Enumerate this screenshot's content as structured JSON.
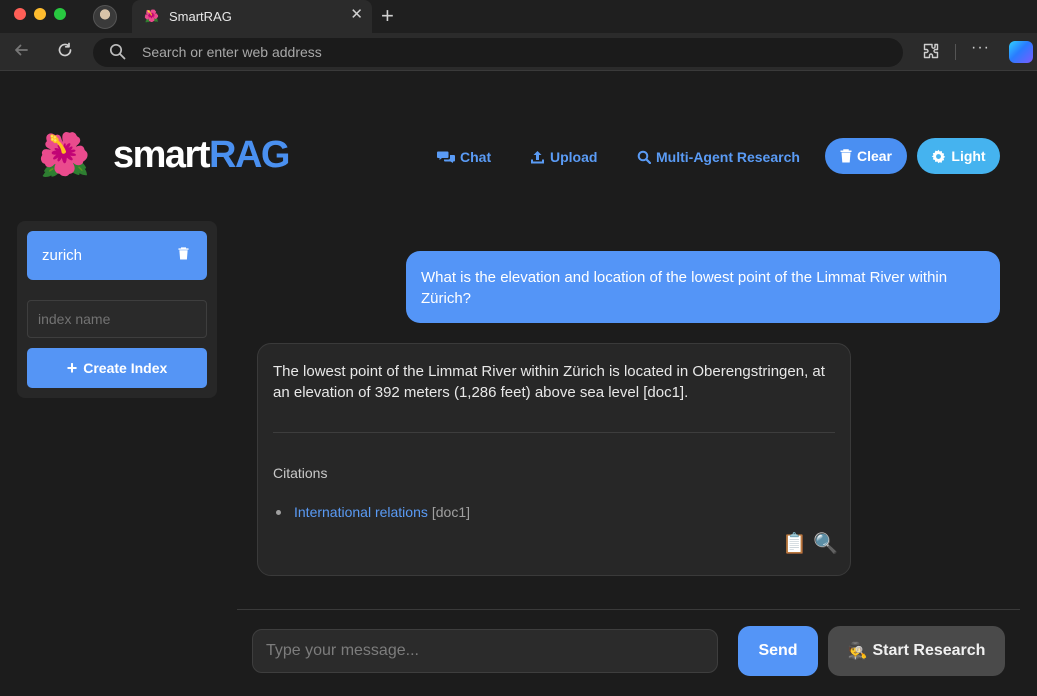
{
  "browser": {
    "tab_title": "SmartRAG",
    "tab_favicon": "🌺",
    "address_placeholder": "Search or enter web address",
    "new_tab_glyph": "+",
    "close_glyph": "✕",
    "more_glyph": "···"
  },
  "header": {
    "logo_emoji": "🌺",
    "logo_smart": "smart",
    "logo_rag": "RAG",
    "nav": {
      "chat": "Chat",
      "upload": "Upload",
      "research": "Multi-Agent Research"
    },
    "clear_label": "Clear",
    "theme_label": "Light"
  },
  "sidebar": {
    "indexes": [
      {
        "name": "zurich"
      }
    ],
    "index_input_placeholder": "index name",
    "create_label": "Create Index",
    "create_prefix": "+"
  },
  "chat": {
    "user_message": "What is the elevation and location of the lowest point of the Limmat River within Zürich?",
    "bot_message": "The lowest point of the Limmat River within Zürich is located in Oberengstringen, at an elevation of 392 meters (1,286 feet) above sea level [doc1].",
    "citations_heading": "Citations",
    "citations": [
      {
        "title": "International relations",
        "ref": "[doc1]"
      }
    ],
    "copy_icon": "📋",
    "inspect_icon": "🔍"
  },
  "composer": {
    "placeholder": "Type your message...",
    "send_label": "Send",
    "research_emoji": "🕵️",
    "research_label": "Start Research"
  },
  "colors": {
    "accent": "#5495f7",
    "link": "#5a9bf5",
    "light_button": "#45b3ef",
    "background": "#1c1c1c"
  }
}
